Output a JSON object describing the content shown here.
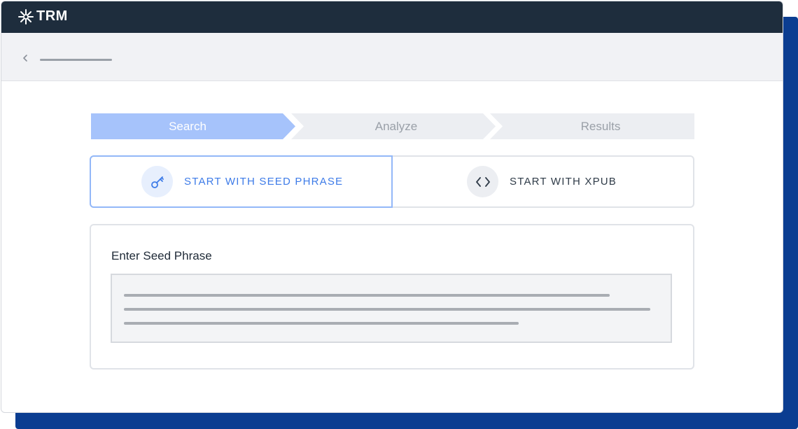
{
  "app": {
    "logo_text": "TRM"
  },
  "colors": {
    "brand_dark": "#1e2d3d",
    "accent": "#3d7be8",
    "shadow_blue": "#0b3d91"
  },
  "steps": [
    {
      "label": "Search",
      "state": "active"
    },
    {
      "label": "Analyze",
      "state": "inactive"
    },
    {
      "label": "Results",
      "state": "inactive"
    }
  ],
  "options": {
    "seed": {
      "label": "START WITH SEED PHRASE",
      "icon": "key-icon",
      "selected": true
    },
    "xpub": {
      "label": "START WITH XPUB",
      "icon": "code-icon",
      "selected": false
    }
  },
  "panel": {
    "title": "Enter Seed Phrase"
  }
}
